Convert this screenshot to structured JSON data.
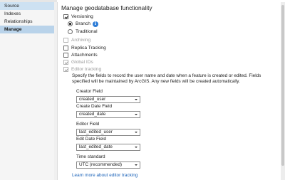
{
  "sidebar": {
    "items": [
      {
        "label": "Source"
      },
      {
        "label": "Indexes"
      },
      {
        "label": "Relationships"
      },
      {
        "label": "Manage"
      }
    ]
  },
  "main": {
    "heading": "Manage geodatabase functionality",
    "versioning": {
      "label": "Versioning",
      "checked": true
    },
    "branch": {
      "label": "Branch",
      "selected": true
    },
    "traditional": {
      "label": "Traditional",
      "selected": false
    },
    "archiving": {
      "label": "Archiving",
      "checked": false,
      "disabled": true
    },
    "replica_tracking": {
      "label": "Replica Tracking",
      "checked": false
    },
    "attachments": {
      "label": "Attachments",
      "checked": false
    },
    "global_ids": {
      "label": "Global IDs",
      "checked": true,
      "disabled": true
    },
    "editor_tracking": {
      "label": "Editor tracking",
      "checked": true,
      "disabled": true
    },
    "description": "Specify the fields to record the user name and date when a feature is created or edited. Fields specified will be maintained by ArcGIS. Any new fields will be created automatically.",
    "creator_field": {
      "label": "Creator Field",
      "value": "created_user"
    },
    "create_date_field": {
      "label": "Create Date Field",
      "value": "created_date"
    },
    "editor_field": {
      "label": "Editor Field",
      "value": "last_edited_user"
    },
    "edit_date_field": {
      "label": "Edit Date Field",
      "value": "last_edited_date"
    },
    "time_standard": {
      "label": "Time standard",
      "value": "UTC (recommended)"
    },
    "learn_more": "Learn more about editor tracking"
  },
  "colors": {
    "selected_nav": "#cde1f2",
    "active_nav": "#b9d3ea",
    "link": "#1a62b8",
    "info_icon": "#2b7bd6"
  }
}
